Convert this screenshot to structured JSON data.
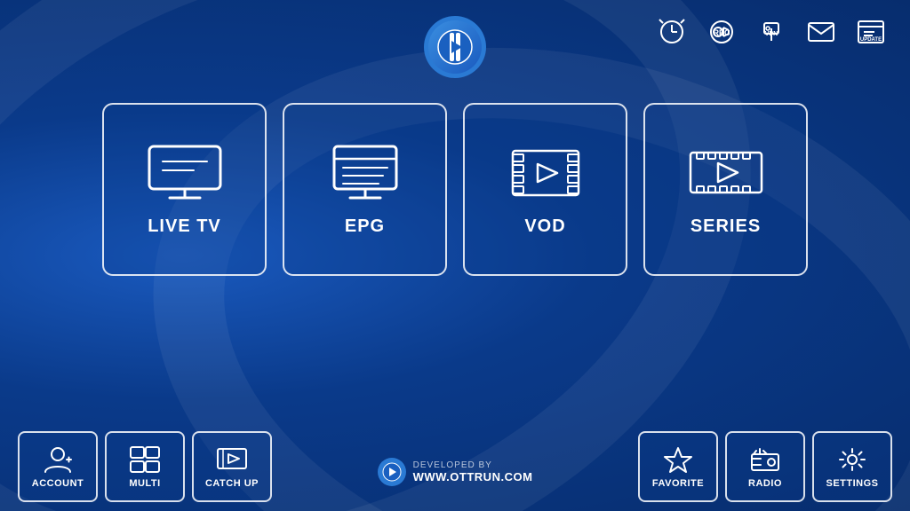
{
  "app": {
    "logo_alt": "OTT Player Logo"
  },
  "top_icons": [
    {
      "name": "alarm-icon",
      "label": "ALARM"
    },
    {
      "name": "rec-icon",
      "label": "REC"
    },
    {
      "name": "vpn-icon",
      "label": "VPN"
    },
    {
      "name": "msg-icon",
      "label": "MSG"
    },
    {
      "name": "update-icon",
      "label": "UPDATE"
    }
  ],
  "main_cards": [
    {
      "id": "live-tv",
      "label": "LIVE TV",
      "icon": "tv"
    },
    {
      "id": "epg",
      "label": "EPG",
      "icon": "epg"
    },
    {
      "id": "vod",
      "label": "VOD",
      "icon": "vod"
    },
    {
      "id": "series",
      "label": "SERIES",
      "icon": "series"
    }
  ],
  "bottom_left": [
    {
      "id": "account",
      "label": "ACCOUNT",
      "icon": "account"
    },
    {
      "id": "multi",
      "label": "MULTI",
      "icon": "multi"
    },
    {
      "id": "catch-up",
      "label": "CATCH UP",
      "icon": "catchup"
    }
  ],
  "bottom_right": [
    {
      "id": "favorite",
      "label": "FAVORITE",
      "icon": "favorite"
    },
    {
      "id": "radio",
      "label": "RADIO",
      "icon": "radio"
    },
    {
      "id": "settings",
      "label": "SETTINGS",
      "icon": "settings"
    }
  ],
  "developer": {
    "prefix": "DEVELOPED BY",
    "url": "WWW.OTTRUN.COM"
  }
}
